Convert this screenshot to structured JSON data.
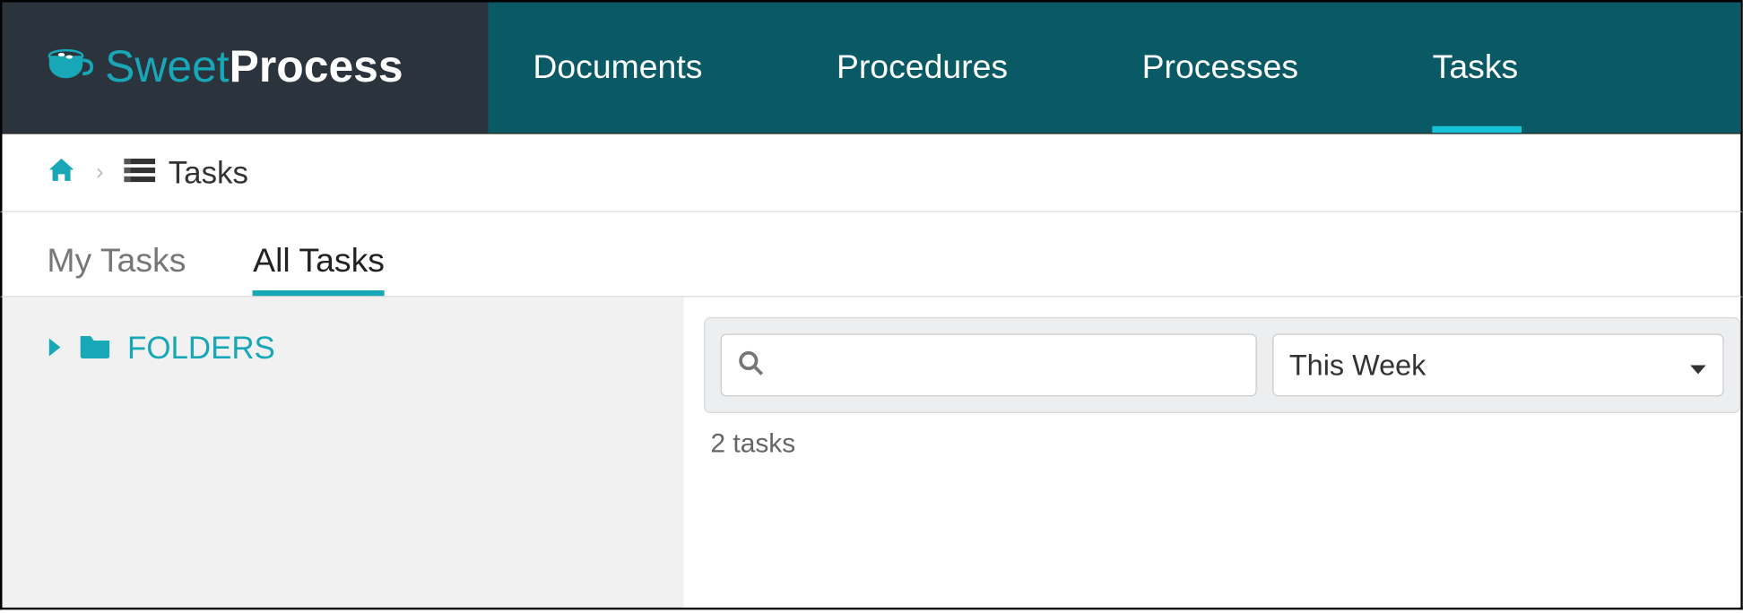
{
  "brand": {
    "sweet": "Sweet",
    "process": "Process"
  },
  "nav": {
    "items": [
      {
        "label": "Documents",
        "active": false
      },
      {
        "label": "Procedures",
        "active": false
      },
      {
        "label": "Processes",
        "active": false
      },
      {
        "label": "Tasks",
        "active": true
      }
    ]
  },
  "breadcrumb": {
    "current": "Tasks"
  },
  "subtabs": {
    "items": [
      {
        "label": "My Tasks",
        "active": false
      },
      {
        "label": "All Tasks",
        "active": true
      }
    ]
  },
  "sidebar": {
    "folders_label": "FOLDERS"
  },
  "filters": {
    "search_value": "",
    "search_placeholder": "",
    "date_range_selected": "This Week"
  },
  "status": {
    "task_count_text": "2 tasks"
  }
}
